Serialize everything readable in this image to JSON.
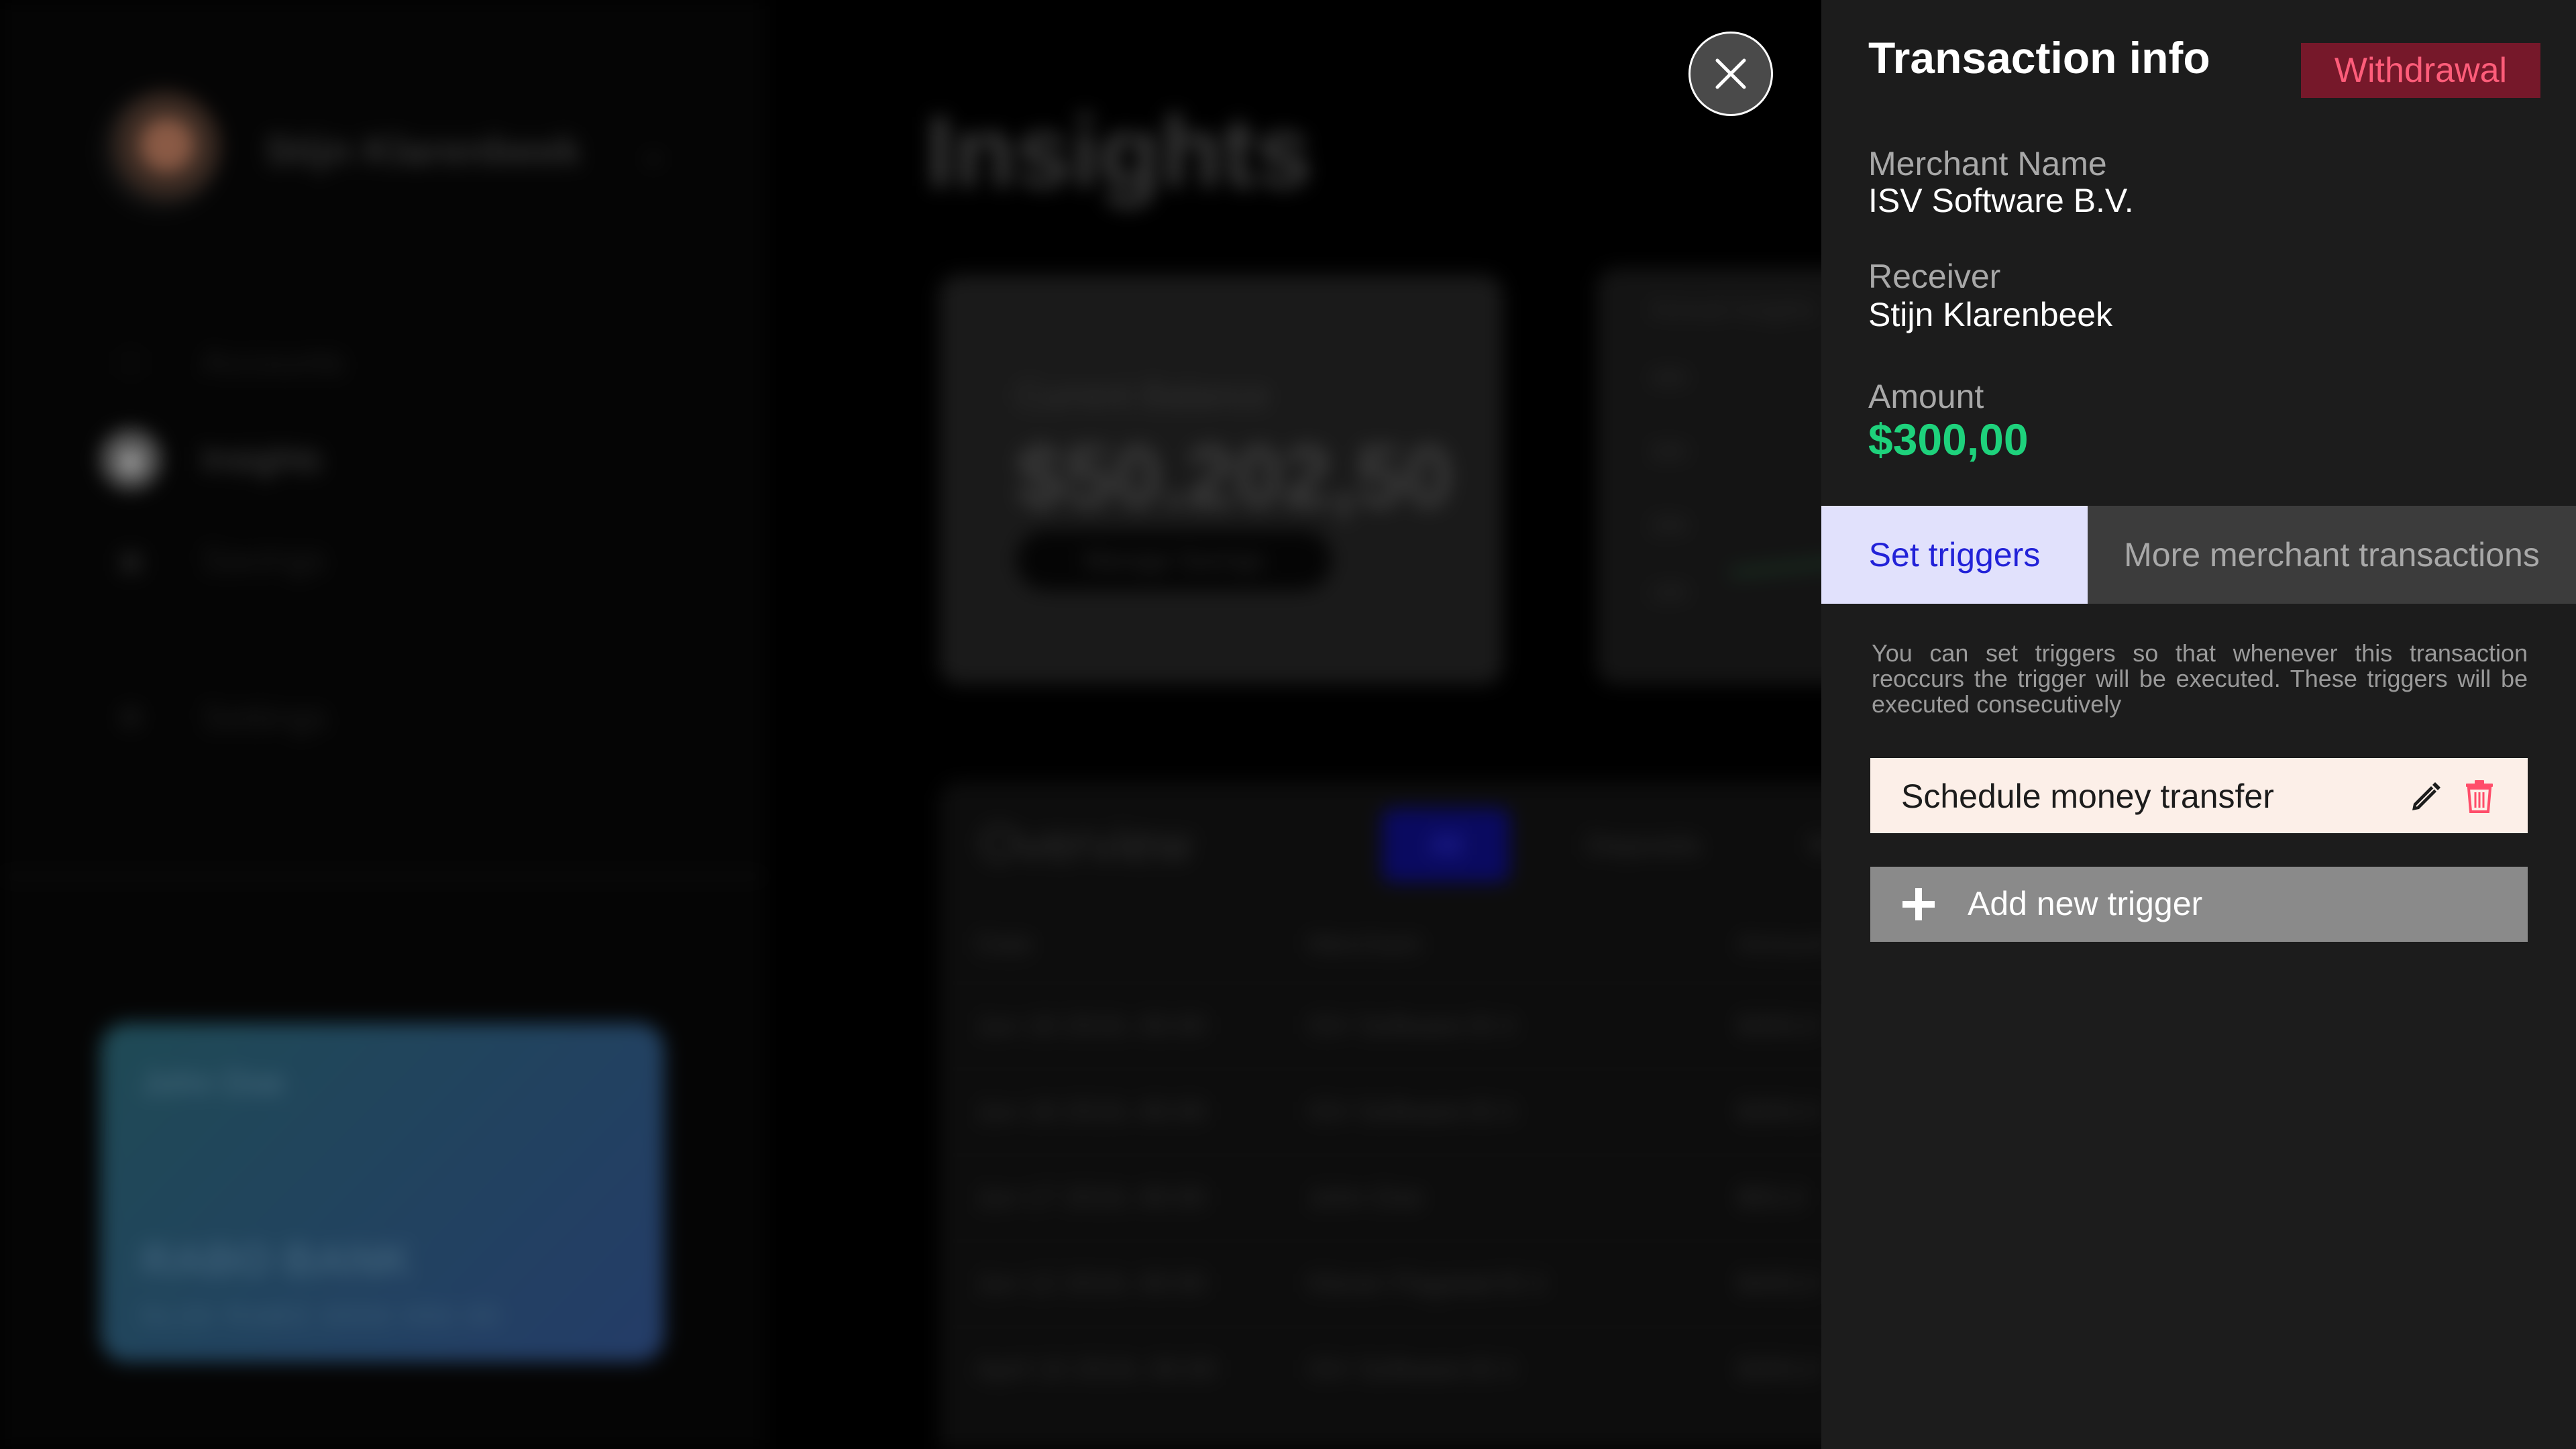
{
  "background": {
    "user_name": "Stijn Klarenbeek",
    "nav": [
      {
        "label": "Accounts",
        "icon": "wallet-icon"
      },
      {
        "label": "Insights",
        "icon": "insights-icon"
      },
      {
        "label": "Savings",
        "icon": "savings-icon"
      },
      {
        "label": "Settings",
        "icon": "gear-icon"
      }
    ],
    "card": {
      "name": "John Doe",
      "bank": "RABO BANK",
      "number": "NL00 RABO 0000 000 00"
    },
    "page_title": "Insights",
    "balance": {
      "label": "Current Balance",
      "value": "$50.202,50",
      "button": "Manage Savings"
    },
    "graph": {
      "title": "Annual Insights",
      "ticks": [
        "40K",
        "30K",
        "20K",
        "10K"
      ]
    },
    "overview": {
      "title": "Overview",
      "filters": [
        "All",
        "Deposits",
        "Wi"
      ],
      "columns": [
        "Date",
        "Merchant",
        "Amount"
      ],
      "rows": [
        {
          "date": "Jun 18 2019, 00:00",
          "merchant": "ISV Software B.V.",
          "amount": "$300,0"
        },
        {
          "date": "Jun 18 2019, 00:00",
          "merchant": "ISV Software B.V.",
          "amount": "$300,0"
        },
        {
          "date": "Jun 17 2019, 00:00",
          "merchant": "John Doe",
          "amount": "$50,0"
        },
        {
          "date": "Jun 12 2019, 00:00",
          "merchant": "Klever Flagstad B.V.",
          "amount": "$400,0"
        },
        {
          "date": "April 10 2019, 00:00",
          "merchant": "ISV Software B.V.",
          "amount": "$300,0"
        }
      ]
    }
  },
  "panel": {
    "title": "Transaction info",
    "badge": "Withdrawal",
    "colors": {
      "badge_bg": "#76182a",
      "badge_text": "#ff5d7a",
      "amount": "#1ed27c",
      "tab_active_bg": "#e1e1fc",
      "tab_active_text": "#2222d8",
      "delete": "#ff4d6a"
    },
    "merchant_label": "Merchant Name",
    "merchant_value": "ISV Software B.V.",
    "receiver_label": "Receiver",
    "receiver_value": "Stijn Klarenbeek",
    "amount_label": "Amount",
    "amount_value": "$300,00",
    "tabs": {
      "active": "Set triggers",
      "inactive": "More merchant transactions"
    },
    "help_text": "You can set triggers so that whenever this transaction reoccurs the trigger will be executed. These triggers will be executed consecutively",
    "triggers": [
      {
        "label": "Schedule money transfer",
        "edit_icon": "pencil-icon",
        "delete_icon": "trash-icon"
      }
    ],
    "add_trigger": "Add new trigger"
  }
}
